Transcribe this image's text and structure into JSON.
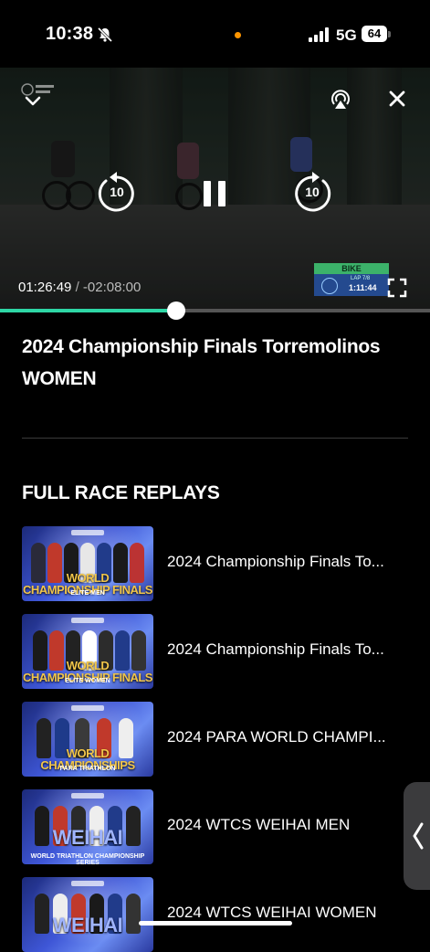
{
  "status_bar": {
    "time": "10:38",
    "network": "5G",
    "battery": "64",
    "icons": [
      "bell-slash-icon",
      "signal-icon",
      "battery-icon"
    ],
    "indicator_color": "#ff9500"
  },
  "player": {
    "current_time": "01:26:49",
    "separator": "/",
    "remaining_time": "-02:08:00",
    "rewind_seconds": "10",
    "forward_seconds": "10",
    "progress": 0.41,
    "progress_color": "#2ed7a5",
    "overlay": {
      "discipline": "BIKE",
      "lap": "LAP 7/8",
      "lap_time": "1:11:44"
    },
    "icons": [
      "chevron-down-icon",
      "airplay-icon",
      "close-icon",
      "rewind-10-icon",
      "pause-icon",
      "forward-10-icon",
      "fullscreen-icon"
    ]
  },
  "video_title": "2024 Championship Finals Torremolinos WOMEN",
  "section": {
    "heading": "FULL RACE REPLAYS"
  },
  "replays": [
    {
      "label": "2024 Championship Finals To...",
      "thumb_title": "WORLD CHAMPIONSHIP FINALS",
      "thumb_sub": "ELITE MEN"
    },
    {
      "label": "2024 Championship Finals To...",
      "thumb_title": "WORLD CHAMPIONSHIP FINALS",
      "thumb_sub": "ELITE WOMEN"
    },
    {
      "label": "2024 PARA WORLD CHAMPI...",
      "thumb_title": "WORLD CHAMPIONSHIPS",
      "thumb_sub": "PARA TRIATHLON"
    },
    {
      "label": "2024 WTCS WEIHAI MEN",
      "thumb_title": "WEIHAI",
      "thumb_sub": "WORLD TRIATHLON CHAMPIONSHIP SERIES"
    },
    {
      "label": "2024 WTCS WEIHAI WOMEN",
      "thumb_title": "WEIHAI",
      "thumb_sub": ""
    }
  ]
}
